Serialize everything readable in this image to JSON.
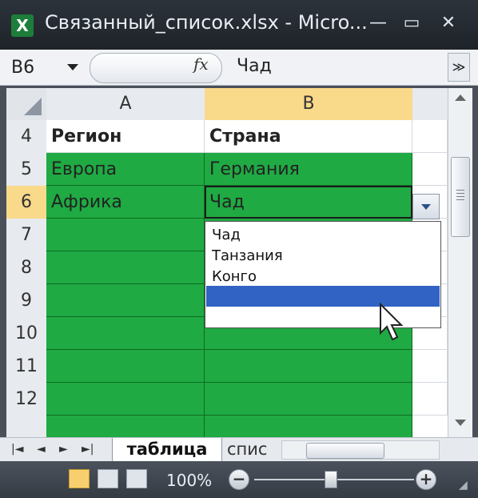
{
  "window": {
    "title": "Связанный_список.xlsx - Micro...",
    "app_icon": "excel-icon",
    "minimize_symbol": "—",
    "restore_symbol": "▭",
    "close_symbol": "✕"
  },
  "formula_bar": {
    "name_box": "B6",
    "fx_label": "fx",
    "value": "Чад",
    "expand_symbol": "≫"
  },
  "columns": [
    "A",
    "B"
  ],
  "rows": [
    {
      "num": "4",
      "a": "Регион",
      "b": "Страна"
    },
    {
      "num": "5",
      "a": "Европа",
      "b": "Германия"
    },
    {
      "num": "6",
      "a": "Африка",
      "b": "Чад"
    },
    {
      "num": "7",
      "a": "",
      "b": ""
    },
    {
      "num": "8",
      "a": "",
      "b": ""
    },
    {
      "num": "9",
      "a": "",
      "b": ""
    },
    {
      "num": "10",
      "a": "",
      "b": ""
    },
    {
      "num": "11",
      "a": "",
      "b": ""
    },
    {
      "num": "12",
      "a": "",
      "b": ""
    }
  ],
  "dropdown": {
    "items": [
      "Чад",
      "Танзания",
      "Конго",
      ""
    ],
    "selected_index": 3
  },
  "sheet_tabs": {
    "nav": [
      "|◄",
      "◄",
      "►",
      "►|"
    ],
    "active": "таблица",
    "other": "спис"
  },
  "status_bar": {
    "zoom": "100%",
    "zoom_out": "−",
    "zoom_in": "+"
  },
  "colors": {
    "fill": "#1faa43",
    "selection_header": "#f9d98a",
    "dropdown_highlight": "#3163c5"
  }
}
